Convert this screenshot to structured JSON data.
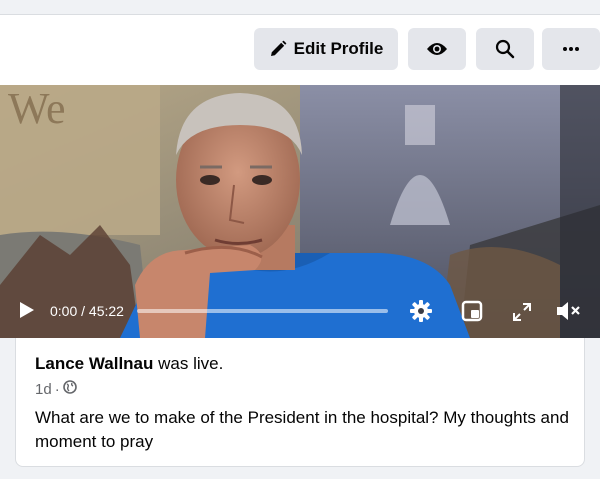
{
  "toolbar": {
    "edit_profile_label": "Edit Profile",
    "view_icon": "eye-icon",
    "search_icon": "search-icon",
    "more_icon": "more-horizontal-icon"
  },
  "video": {
    "time_display": "0:00 / 45:22",
    "progress": 0,
    "icons": [
      "play-icon",
      "settings-gear-icon",
      "miniplayer-icon",
      "fullscreen-icon",
      "volume-muted-icon"
    ]
  },
  "post": {
    "author": "Lance Wallnau",
    "action": " was live.",
    "age": "1d",
    "separator": "·",
    "privacy_icon": "globe-icon",
    "text": "What are we to make of the President in the hospital? My thoughts and moment to pray"
  },
  "colors": {
    "button_bg": "#e4e6eb",
    "page_bg": "#f0f2f5",
    "text_primary": "#050505",
    "text_secondary": "#65676b"
  }
}
